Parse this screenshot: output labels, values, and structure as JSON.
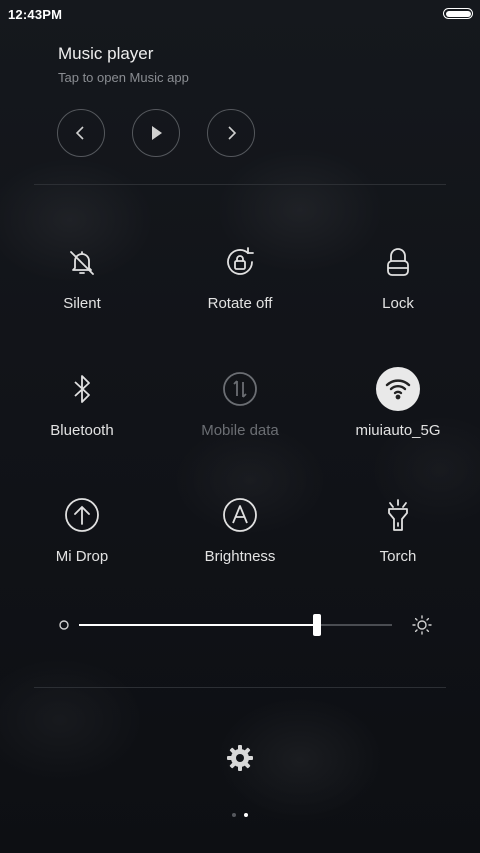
{
  "status_bar": {
    "time": "12:43PM",
    "battery_icon": "battery-icon"
  },
  "music": {
    "title": "Music player",
    "subtitle": "Tap to open Music app",
    "controls": [
      "previous-icon",
      "play-icon",
      "next-icon"
    ]
  },
  "toggles": [
    {
      "label": "Silent",
      "icon": "silent-bell-icon",
      "state": "off"
    },
    {
      "label": "Rotate off",
      "icon": "rotate-lock-icon",
      "state": "off"
    },
    {
      "label": "Lock",
      "icon": "lock-icon",
      "state": "off"
    },
    {
      "label": "Bluetooth",
      "icon": "bluetooth-icon",
      "state": "off"
    },
    {
      "label": "Mobile data",
      "icon": "mobile-data-icon",
      "state": "disabled"
    },
    {
      "label": "miuiauto_5G",
      "icon": "wifi-icon",
      "state": "on"
    },
    {
      "label": "Mi Drop",
      "icon": "mi-drop-icon",
      "state": "off"
    },
    {
      "label": "Brightness",
      "icon": "auto-brightness-icon",
      "state": "off"
    },
    {
      "label": "Torch",
      "icon": "torch-icon",
      "state": "off"
    }
  ],
  "brightness": {
    "level_fraction": 0.76
  },
  "pager": {
    "pages": 2,
    "current": 2
  },
  "colors": {
    "active_toggle_bg": "#e9e9e9",
    "background": "#111318",
    "dim_text": "#6b6e73"
  }
}
